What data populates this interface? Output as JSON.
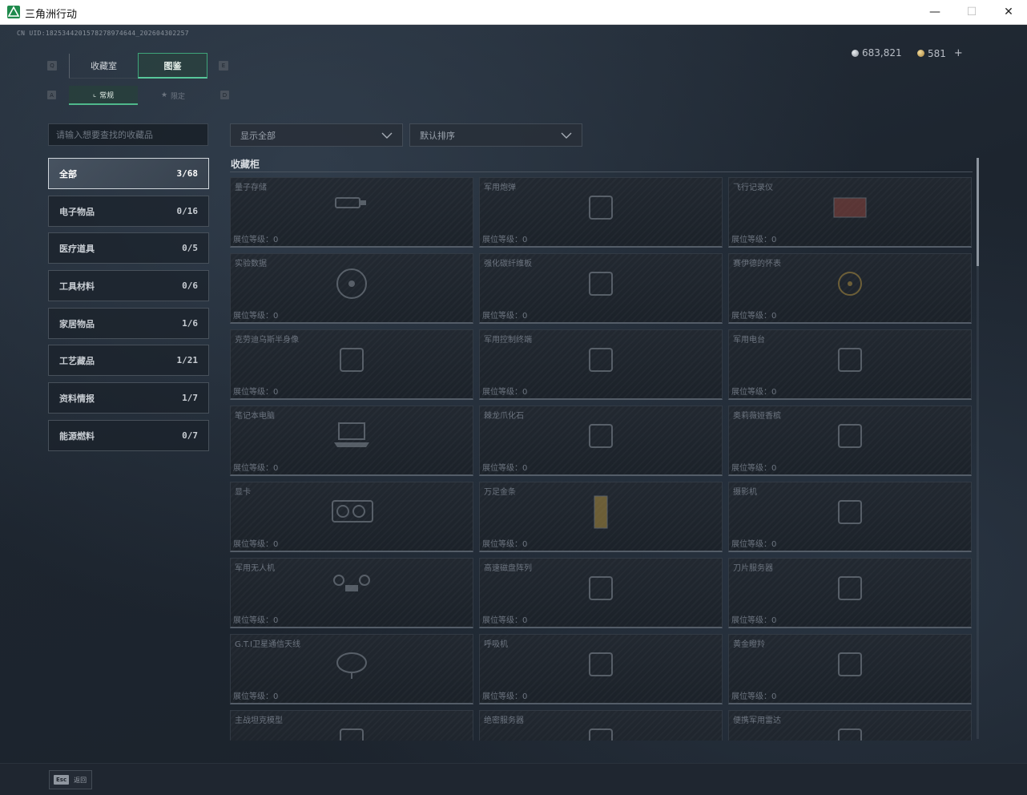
{
  "window": {
    "title": "三角洲行动",
    "minimize": "—",
    "maximize": "☐",
    "close": "✕"
  },
  "header": {
    "uid": "CN UID:1825344201578278974644_202604302257",
    "currency_silver": "683,821",
    "currency_gold": "581",
    "add": "+"
  },
  "tabs": {
    "key_left": "Q",
    "key_right": "E",
    "collection": "收藏室",
    "gallery": "图鉴",
    "subkey_left": "A",
    "subkey_right": "D",
    "normal": "常规",
    "limited": "限定"
  },
  "search": {
    "placeholder": "请输入想要查找的收藏品"
  },
  "filters": {
    "show": "显示全部",
    "sort": "默认排序"
  },
  "categories": [
    {
      "label": "全部",
      "count": "3/68"
    },
    {
      "label": "电子物品",
      "count": "0/16"
    },
    {
      "label": "医疗道具",
      "count": "0/5"
    },
    {
      "label": "工具材料",
      "count": "0/6"
    },
    {
      "label": "家居物品",
      "count": "1/6"
    },
    {
      "label": "工艺藏品",
      "count": "1/21"
    },
    {
      "label": "资料情报",
      "count": "1/7"
    },
    {
      "label": "能源燃料",
      "count": "0/7"
    }
  ],
  "section": {
    "title": "收藏柜"
  },
  "level_prefix": "展位等级：",
  "items": [
    {
      "name": "量子存储",
      "level": "展位等级：0",
      "icon": "usb-drive-icon"
    },
    {
      "name": "军用炮弹",
      "level": "展位等级：0",
      "icon": "shell-icon"
    },
    {
      "name": "飞行记录仪",
      "level": "展位等级：0",
      "icon": "flight-recorder-icon"
    },
    {
      "name": "实验数据",
      "level": "展位等级：0",
      "icon": "disc-icon"
    },
    {
      "name": "强化碳纤维板",
      "level": "展位等级：0",
      "icon": "panel-icon"
    },
    {
      "name": "赛伊德的怀表",
      "level": "展位等级：0",
      "icon": "pocket-watch-icon"
    },
    {
      "name": "克劳迪乌斯半身像",
      "level": "展位等级：0",
      "icon": "bust-icon"
    },
    {
      "name": "军用控制终端",
      "level": "展位等级：0",
      "icon": "terminal-icon"
    },
    {
      "name": "军用电台",
      "level": "展位等级：0",
      "icon": "radio-icon"
    },
    {
      "name": "笔记本电脑",
      "level": "展位等级：0",
      "icon": "laptop-icon"
    },
    {
      "name": "棘龙爪化石",
      "level": "展位等级：0",
      "icon": "fossil-icon"
    },
    {
      "name": "奥莉薇娅香槟",
      "level": "展位等级：0",
      "icon": "champagne-icon"
    },
    {
      "name": "显卡",
      "level": "展位等级：0",
      "icon": "gpu-icon"
    },
    {
      "name": "万足金条",
      "level": "展位等级：0",
      "icon": "gold-bar-icon"
    },
    {
      "name": "摄影机",
      "level": "展位等级：0",
      "icon": "camera-icon"
    },
    {
      "name": "军用无人机",
      "level": "展位等级：0",
      "icon": "drone-icon"
    },
    {
      "name": "高速磁盘阵列",
      "level": "展位等级：0",
      "icon": "disk-array-icon"
    },
    {
      "name": "刀片服务器",
      "level": "展位等级：0",
      "icon": "blade-server-icon"
    },
    {
      "name": "G.T.I卫星通信天线",
      "level": "展位等级：0",
      "icon": "satellite-dish-icon"
    },
    {
      "name": "呼吸机",
      "level": "展位等级：0",
      "icon": "ventilator-icon"
    },
    {
      "name": "黄金瞪羚",
      "level": "展位等级：0",
      "icon": "gazelle-icon"
    },
    {
      "name": "主战坦克模型",
      "level": "",
      "icon": "tank-icon"
    },
    {
      "name": "绝密服务器",
      "level": "",
      "icon": "server-icon"
    },
    {
      "name": "便携军用雷达",
      "level": "",
      "icon": "radar-icon"
    }
  ],
  "footer": {
    "esc_key": "Esc",
    "back": "返回"
  },
  "colors": {
    "accent": "#4fb88b",
    "background": "#1d252f",
    "card": "#222830"
  }
}
